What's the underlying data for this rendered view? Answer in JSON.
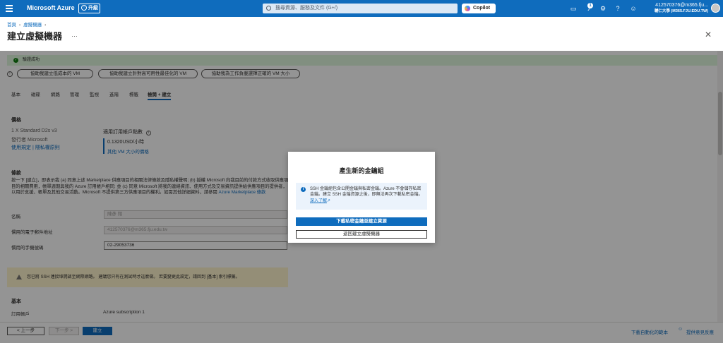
{
  "topbar": {
    "brand": "Microsoft Azure",
    "upgrade_label": "升級",
    "search_placeholder": "搜尋資源、服務及文件 (G+/)",
    "copilot_label": "Copilot",
    "notification_count": "1",
    "account_email": "412570376@m365.fju...",
    "account_org": "輔仁大學 (M365.FJU.EDU.TW)"
  },
  "breadcrumb": {
    "home": "首頁",
    "vms": "虛擬機器"
  },
  "page": {
    "title": "建立虛擬機器",
    "more": "…"
  },
  "banner": {
    "success": "驗證成功"
  },
  "assist": [
    "協助我建立低成本的 VM",
    "協助我建立針對高可用性最佳化的 VM",
    "協助我為工作負載選擇正確的 VM 大小"
  ],
  "tabs": [
    "基本",
    "磁碟",
    "網路",
    "管理",
    "監視",
    "進階",
    "標籤",
    "檢閱 + 建立"
  ],
  "price": {
    "heading": "價格",
    "size": "1 X Standard D2s v3",
    "publisher": "發行者 Microsoft",
    "terms_links": "使用規定 | 隱私權原則",
    "subscription_credit_label": "適用訂用帳戶點數",
    "price_value": "0.1320USD/小時",
    "price_link": "其他 VM 大小的價格"
  },
  "terms": {
    "heading": "條款",
    "body": "按一下 [建立]，即表示我 (a) 同意上述 Marketplace 供應項目的相關法律條款及隱私權聲明; (b) 授權 Microsoft 向我目前的付款方式收取供應項目的相關費用，帳單週期與我的 Azure 訂用帳戶相同; 並 (c) 同意 Microsoft 將我的連絡資訊、使用方式及交易資訊提供給供應項目的提供者，以用於支援、帳單及其他交易活動。Microsoft 不提供第三方供應項目的權利。如需其他詳細資料，請參閱",
    "link": "Azure Marketplace 條款"
  },
  "form": {
    "name_label": "名稱",
    "name_value": "陳彥 翔",
    "email_label": "慣用的電子郵件地址",
    "email_value": "412570376@m365.fju.edu.tw",
    "phone_label": "慣用的手機號碼",
    "phone_value": "02-29053736"
  },
  "warning": {
    "text": "您已將 SSH 連接埠開啟至網際網路。 建議您只有在測試時才這麼做。 若要變更此設定，請回到 [基本] 索引標籤。"
  },
  "basics": {
    "heading": "基本",
    "subscription_label": "訂用帳戶",
    "subscription_value": "Azure subscription 1"
  },
  "footer": {
    "prev": "< 上一步",
    "next": "下一步 >",
    "create": "建立",
    "download_template": "下載自動化的範本",
    "feedback": "提供意見反應"
  },
  "dialog": {
    "title": "產生新的金鑰組",
    "info": "SSH 金鑰組包含公開金鑰與私密金鑰。Azure 不會儲存私密金鑰。建立 SSH 金鑰資源之後，即無法再次下載私密金鑰。",
    "info_link": "深入了解",
    "primary": "下載私密金鑰並建立資源",
    "secondary": "返回建立虛擬機器"
  }
}
